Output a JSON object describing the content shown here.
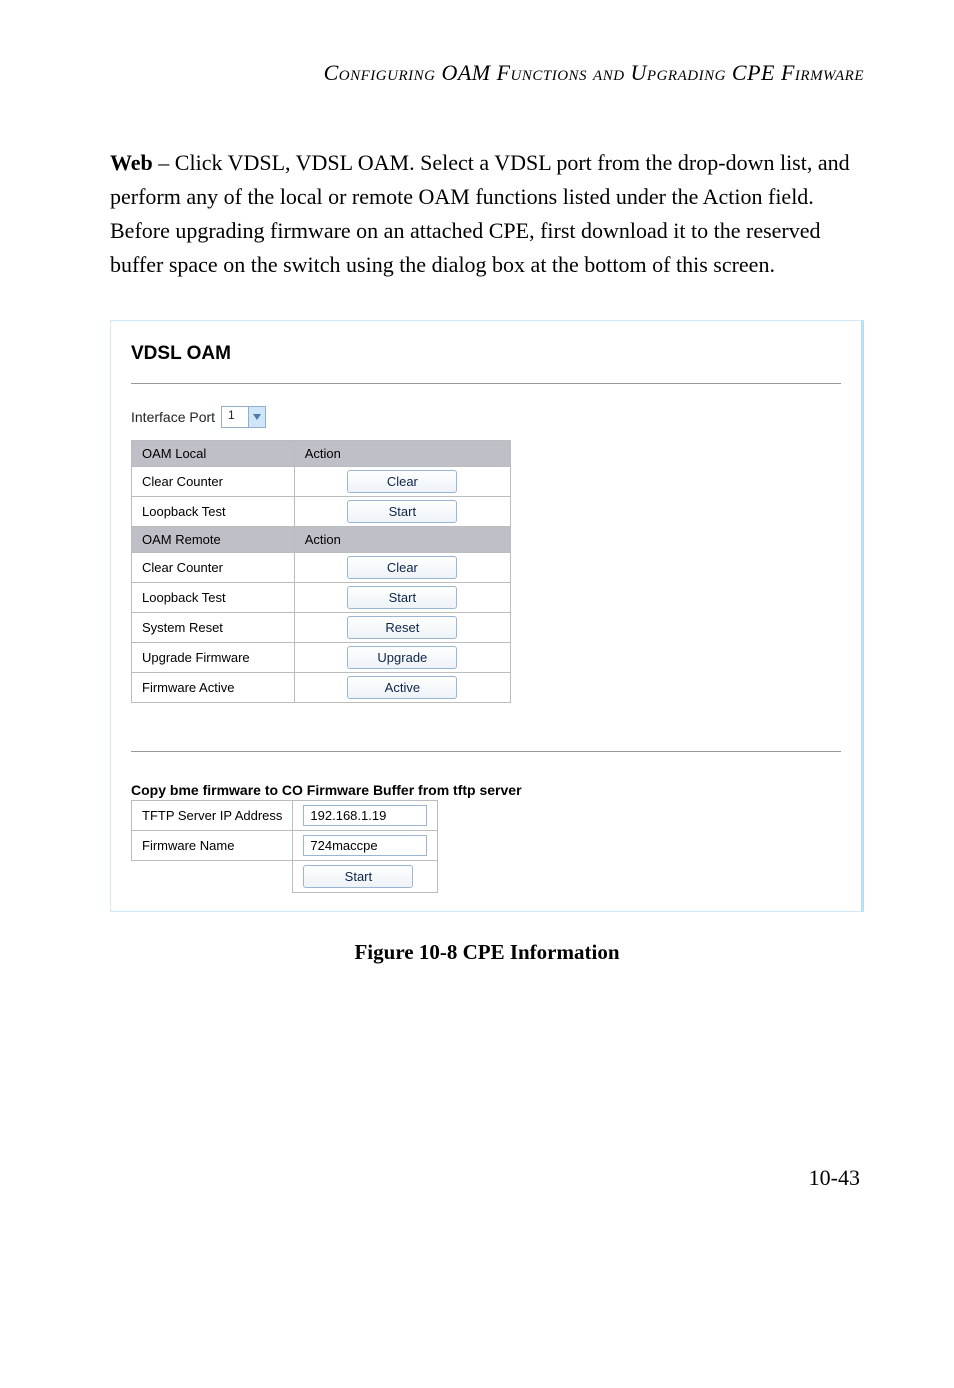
{
  "running_head": "Configuring OAM Functions and Upgrading CPE Firmware",
  "body_strong": "Web",
  "body_rest": " – Click VDSL, VDSL OAM. Select a VDSL port from the drop-down list, and perform any of the local or remote OAM functions listed under the Action field. Before upgrading firmware on an attached CPE, first download it to the reserved buffer space on the switch using the dialog box at the bottom of this screen.",
  "shot": {
    "title": "VDSL OAM",
    "interface_label": "Interface Port",
    "interface_value": "1",
    "headers": {
      "local": "OAM Local",
      "remote": "OAM Remote",
      "action": "Action"
    },
    "rows": {
      "local_clear_label": "Clear Counter",
      "local_clear_btn": "Clear",
      "local_loop_label": "Loopback Test",
      "local_loop_btn": "Start",
      "remote_clear_label": "Clear Counter",
      "remote_clear_btn": "Clear",
      "remote_loop_label": "Loopback Test",
      "remote_loop_btn": "Start",
      "reset_label": "System Reset",
      "reset_btn": "Reset",
      "upgrade_label": "Upgrade Firmware",
      "upgrade_btn": "Upgrade",
      "active_label": "Firmware Active",
      "active_btn": "Active"
    },
    "copy": {
      "heading": "Copy bme firmware to CO Firmware Buffer from tftp server",
      "ip_label": "TFTP Server IP Address",
      "ip_value": "192.168.1.19",
      "fw_label": "Firmware Name",
      "fw_value": "724maccpe",
      "start_btn": "Start"
    }
  },
  "figure_caption": "Figure 10-8  CPE Information",
  "page_number": "10-43"
}
